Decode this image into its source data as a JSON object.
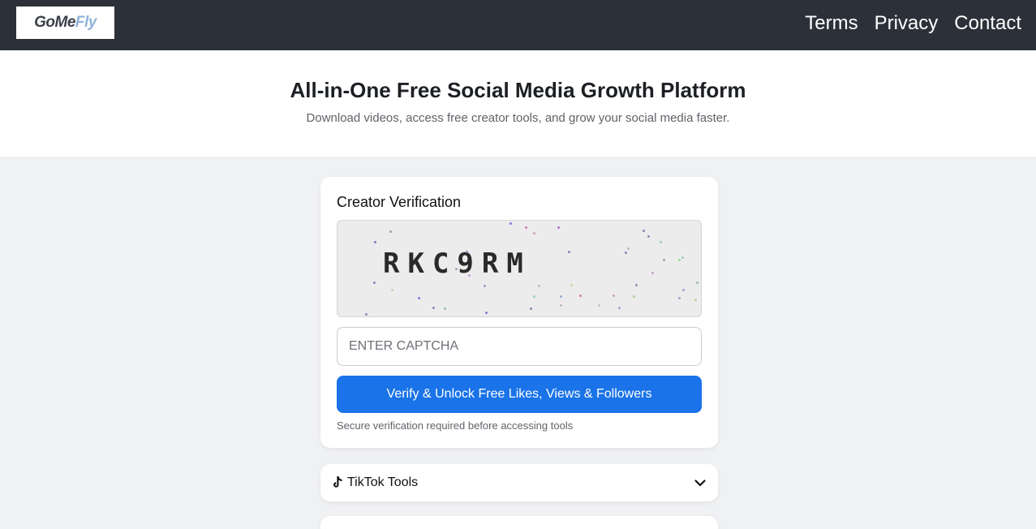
{
  "brand": {
    "logo_text_a": "GoMe",
    "logo_text_b": "Fly"
  },
  "nav": {
    "items": [
      "Terms",
      "Privacy",
      "Contact"
    ]
  },
  "hero": {
    "title": "All-in-One Free Social Media Growth Platform",
    "subtitle": "Download videos, access free creator tools, and grow your social media faster."
  },
  "verify": {
    "title": "Creator Verification",
    "captcha_code": "RKC9RM",
    "input_placeholder": "ENTER CAPTCHA",
    "input_value": "",
    "button_label": "Verify & Unlock Free Likes, Views & Followers",
    "note": "Secure verification required before accessing tools"
  },
  "tools": {
    "tiktok_label": "TikTok Tools",
    "tiktok_icon": "tiktok-icon",
    "expand_icon": "chevron-down-icon"
  },
  "colors": {
    "topbar": "#2c3139",
    "primary_button": "#1a73e8",
    "page_bg": "#f0f1f3"
  }
}
